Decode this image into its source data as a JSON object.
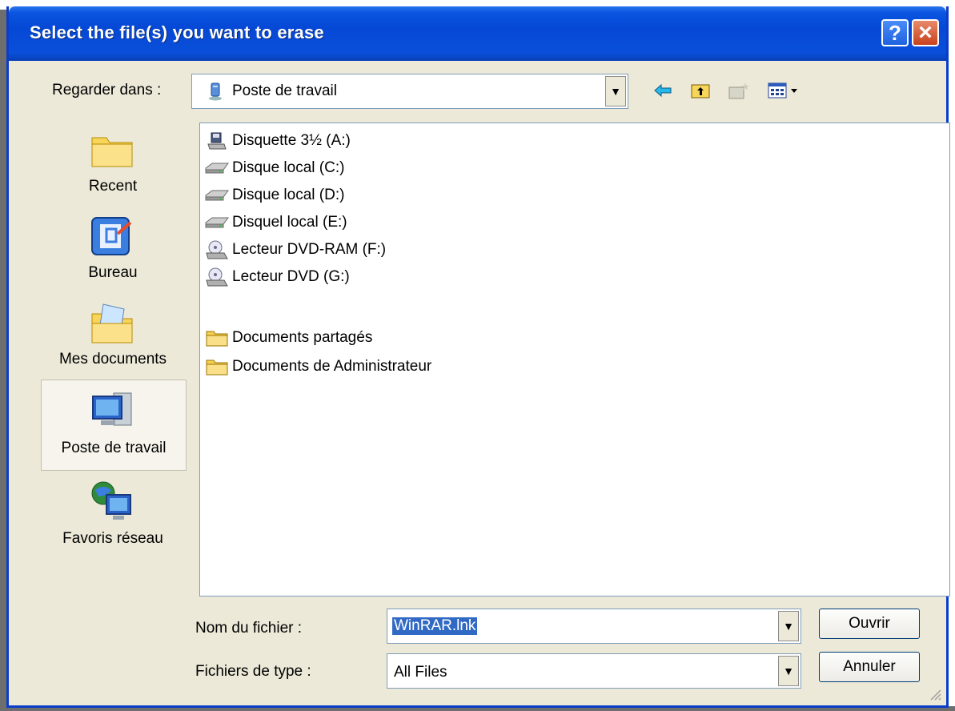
{
  "title": "Select the file(s) you want to erase",
  "title_buttons": {
    "help": "?",
    "close": "×"
  },
  "look_in": {
    "label": "Regarder dans :",
    "value": "Poste de travail",
    "icon": "computer-icon"
  },
  "toolbar": {
    "back_icon": "back-arrow-icon",
    "up_icon": "up-folder-icon",
    "new_folder_icon": "new-folder-icon",
    "view_menu_icon": "view-menu-icon"
  },
  "places": [
    {
      "label": "Recent",
      "icon": "recent-folder-icon"
    },
    {
      "label": "Bureau",
      "icon": "desktop-icon"
    },
    {
      "label": "Mes documents",
      "icon": "my-documents-icon"
    },
    {
      "label": "Poste de travail",
      "icon": "my-computer-icon",
      "selected": true
    },
    {
      "label": "Favoris réseau",
      "icon": "network-icon"
    }
  ],
  "files": [
    {
      "name": "Disquette 3½ (A:)",
      "icon": "floppy-drive-icon"
    },
    {
      "name": "Disque local (C:)",
      "icon": "hard-drive-icon"
    },
    {
      "name": "Disque local (D:)",
      "icon": "hard-drive-icon"
    },
    {
      "name": "Disquel local (E:)",
      "icon": "hard-drive-icon"
    },
    {
      "name": "Lecteur DVD-RAM (F:)",
      "icon": "dvd-drive-icon"
    },
    {
      "name": "Lecteur DVD (G:)",
      "icon": "dvd-drive-icon"
    },
    {
      "name": "Documents partagés",
      "icon": "folder-icon"
    },
    {
      "name": "Documents de Administrateur",
      "icon": "folder-icon"
    }
  ],
  "filename": {
    "label": "Nom du fichier :",
    "value": "WinRAR.lnk"
  },
  "filetype": {
    "label": "Fichiers de type :",
    "value": "All Files"
  },
  "buttons": {
    "open": "Ouvrir",
    "cancel": "Annuler"
  },
  "colors": {
    "title_bar": "#0548d6",
    "dialog_bg": "#ece9d8",
    "selection": "#316ac5"
  }
}
